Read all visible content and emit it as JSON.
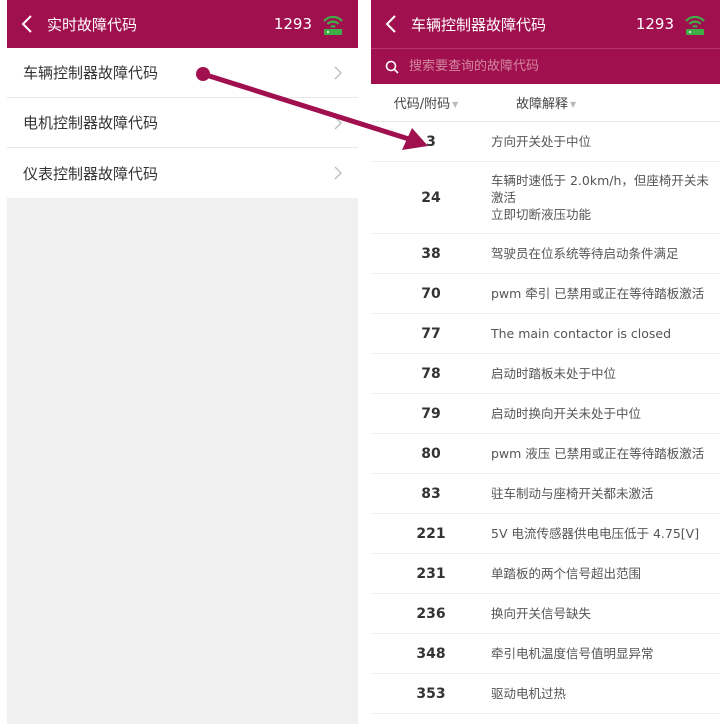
{
  "left": {
    "header": {
      "title": "实时故障代码",
      "count": "1293"
    },
    "menu": [
      {
        "label": "车辆控制器故障代码"
      },
      {
        "label": "电机控制器故障代码"
      },
      {
        "label": "仪表控制器故障代码"
      }
    ]
  },
  "right": {
    "header": {
      "title": "车辆控制器故障代码",
      "count": "1293"
    },
    "search": {
      "placeholder": "搜索要查询的故障代码",
      "value": ""
    },
    "columns": {
      "code": "代码/附码",
      "desc": "故障解释"
    },
    "rows": [
      {
        "code": "3",
        "desc": "方向开关处于中位"
      },
      {
        "code": "24",
        "desc": "车辆时速低于 2.0km/h，但座椅开关未激活\n立即切断液压功能"
      },
      {
        "code": "38",
        "desc": "驾驶员在位系统等待启动条件满足"
      },
      {
        "code": "70",
        "desc": "pwm 牵引 已禁用或正在等待踏板激活"
      },
      {
        "code": "77",
        "desc": "The main contactor is closed"
      },
      {
        "code": "78",
        "desc": "启动时踏板未处于中位"
      },
      {
        "code": "79",
        "desc": "启动时换向开关未处于中位"
      },
      {
        "code": "80",
        "desc": "pwm 液压 已禁用或正在等待踏板激活"
      },
      {
        "code": "83",
        "desc": "驻车制动与座椅开关都未激活"
      },
      {
        "code": "221",
        "desc": "5V 电流传感器供电电压低于 4.75[V]"
      },
      {
        "code": "231",
        "desc": "单踏板的两个信号超出范围"
      },
      {
        "code": "236",
        "desc": "换向开关信号缺失"
      },
      {
        "code": "348",
        "desc": "牵引电机温度信号值明显异常"
      },
      {
        "code": "353",
        "desc": "驱动电机过热"
      }
    ]
  },
  "colors": {
    "brand": "#a1104e",
    "wifi": "#3fae49"
  },
  "icons": {
    "back": "chevron-left-icon",
    "wifi": "wifi-router-icon",
    "search": "search-icon",
    "chevron": "chevron-right-icon",
    "sort": "sort-down-icon"
  }
}
